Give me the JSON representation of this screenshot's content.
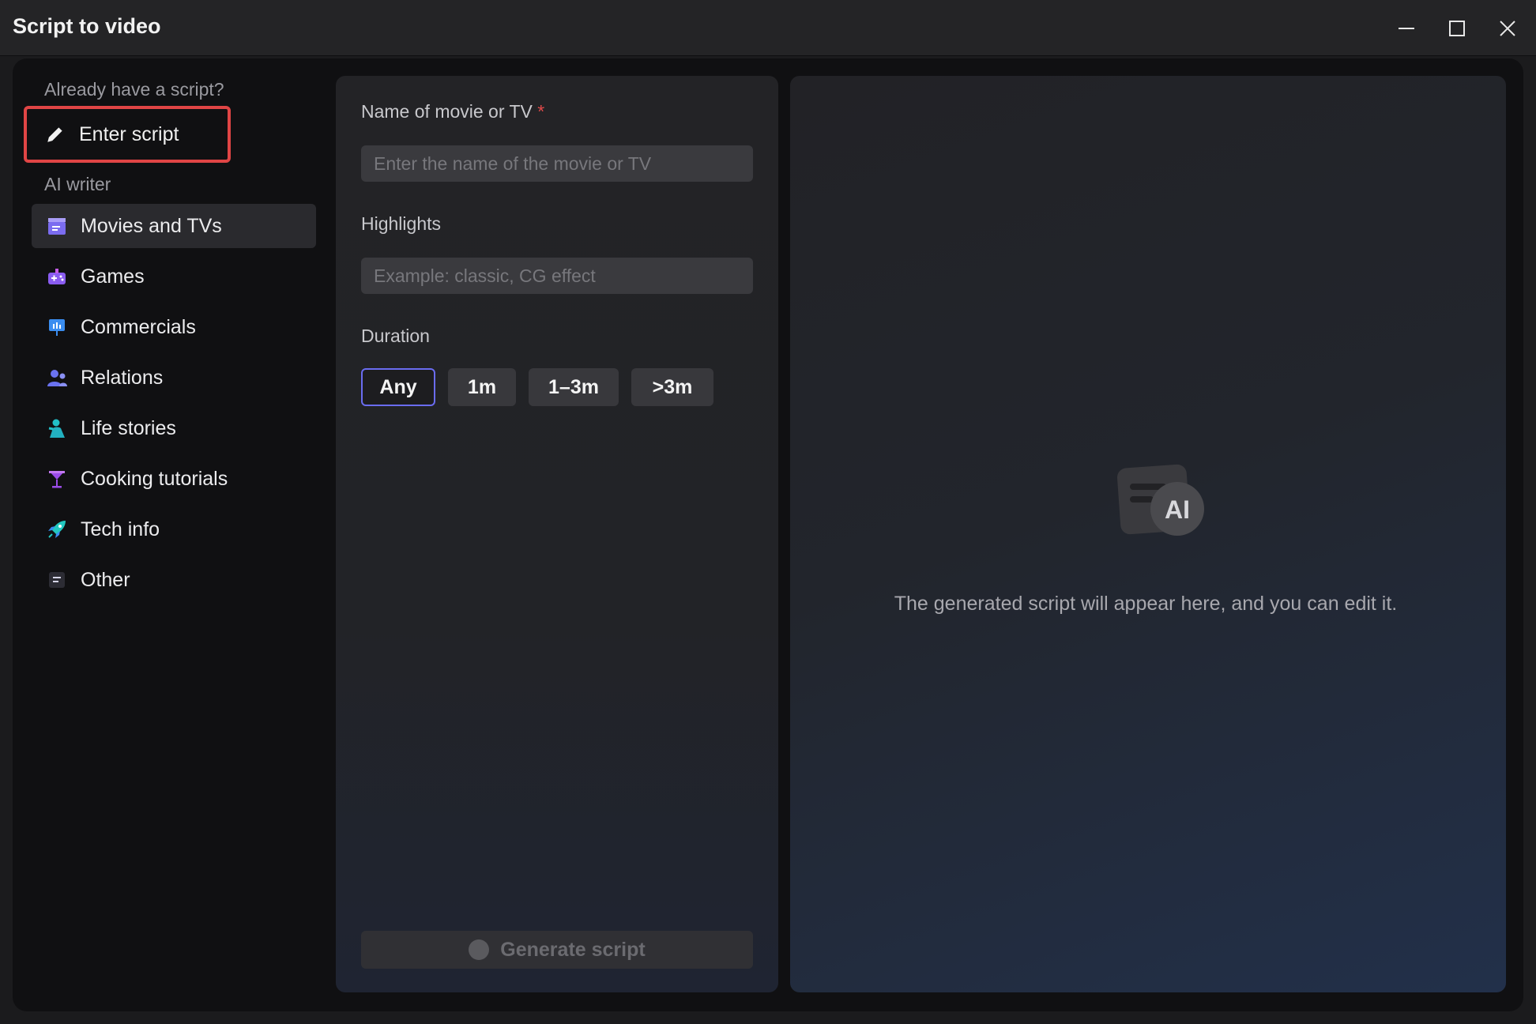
{
  "window": {
    "title": "Script to video"
  },
  "sidebar": {
    "section_have_script": "Already have a script?",
    "enter_script_label": "Enter script",
    "section_ai_writer": "AI writer",
    "items": [
      {
        "label": "Movies and TVs",
        "icon": "clapperboard-icon",
        "active": true
      },
      {
        "label": "Games",
        "icon": "gamepad-icon",
        "active": false
      },
      {
        "label": "Commercials",
        "icon": "presentation-icon",
        "active": false
      },
      {
        "label": "Relations",
        "icon": "people-icon",
        "active": false
      },
      {
        "label": "Life stories",
        "icon": "person-icon",
        "active": false
      },
      {
        "label": "Cooking tutorials",
        "icon": "cocktail-icon",
        "active": false
      },
      {
        "label": "Tech info",
        "icon": "rocket-icon",
        "active": false
      },
      {
        "label": "Other",
        "icon": "list-icon",
        "active": false
      }
    ]
  },
  "form": {
    "name_label": "Name of movie or TV",
    "name_required_mark": "*",
    "name_placeholder": "Enter the name of the movie or TV",
    "name_value": "",
    "highlights_label": "Highlights",
    "highlights_placeholder": "Example: classic, CG effect",
    "highlights_value": "",
    "duration_label": "Duration",
    "duration_options": [
      "Any",
      "1m",
      "1–3m",
      ">3m"
    ],
    "duration_selected": "Any",
    "generate_label": "Generate script"
  },
  "preview": {
    "icon_badge": "AI",
    "message": "The generated script will appear here, and you can edit it."
  },
  "colors": {
    "accent_selected_border": "#6a6cf0",
    "highlight_box": "#e04545",
    "required": "#e04a4a"
  }
}
